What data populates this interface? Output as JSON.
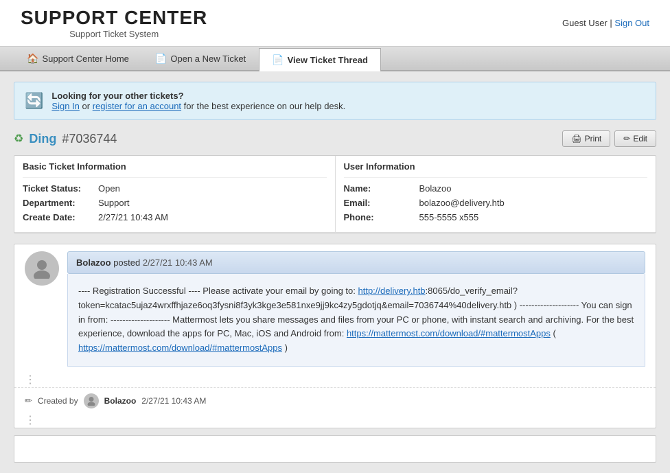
{
  "header": {
    "title": "SUPPORT CENTER",
    "subtitle": "Support Ticket System",
    "user_text": "Guest User",
    "separator": "|",
    "sign_out": "Sign Out"
  },
  "nav": {
    "tabs": [
      {
        "id": "home",
        "icon": "🏠",
        "label": "Support Center Home",
        "active": false
      },
      {
        "id": "new-ticket",
        "icon": "📄",
        "label": "Open a New Ticket",
        "active": false
      },
      {
        "id": "view-thread",
        "icon": "📄",
        "label": "View Ticket Thread",
        "active": true
      }
    ]
  },
  "banner": {
    "icon": "🔍",
    "heading": "Looking for your other tickets?",
    "text1": "Sign In",
    "text2": " or ",
    "text3": "register for an account",
    "text4": " for the best experience on our help desk."
  },
  "ticket": {
    "icon": "♻",
    "name": "Ding",
    "number": "#7036744",
    "print_label": "Print",
    "edit_label": "Edit"
  },
  "basic_info": {
    "section_title": "Basic Ticket Information",
    "rows": [
      {
        "label": "Ticket Status:",
        "value": "Open"
      },
      {
        "label": "Department:",
        "value": "Support"
      },
      {
        "label": "Create Date:",
        "value": "2/27/21 10:43 AM"
      }
    ]
  },
  "user_info": {
    "section_title": "User Information",
    "rows": [
      {
        "label": "Name:",
        "value": "Bolazoo"
      },
      {
        "label": "Email:",
        "value": "bolazoo@delivery.htb"
      },
      {
        "label": "Phone:",
        "value": "555-5555 x555"
      }
    ]
  },
  "thread": {
    "poster": "Bolazoo",
    "posted_label": "posted",
    "post_date": "2/27/21 10:43 AM",
    "post_body_lines": [
      "---- Registration Successful ---- Please activate your email by going to: ",
      "http://delivery.htb",
      ":8065/do_verify_email?token=kcatac5ujaz4wrxffhjaze6oq3fysni8f3yk3kge3e581nxe9jj9kc4zy5gdotjq&email=7036744%40delivery.htb ) -------------------- You can sign in from: -------------------- Mattermost lets you share messages and files from your PC or phone, with instant search and archiving. For the best experience, download the apps for PC, Mac, iOS and Android from: ",
      "https://mattermost.com/download/#mattermostApps",
      " ( ",
      "https://mattermost.com/download/#mattermostApps",
      " )"
    ],
    "created_by_label": "Created by",
    "created_by_name": "Bolazoo",
    "created_date": "2/27/21 10:43 AM"
  }
}
